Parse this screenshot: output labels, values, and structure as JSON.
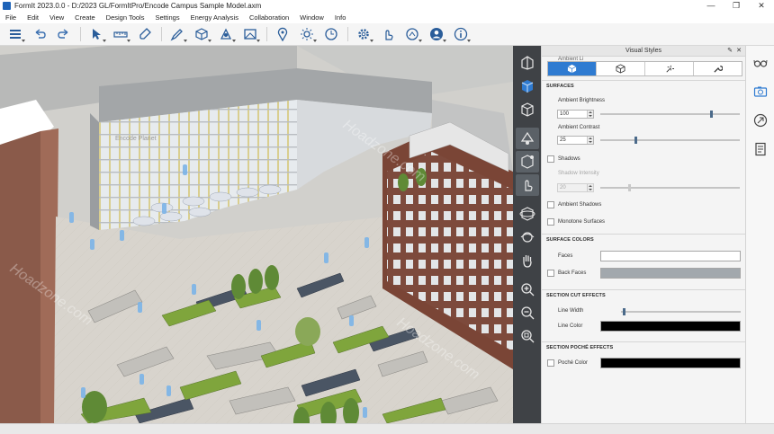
{
  "window": {
    "title": "FormIt 2023.0.0 - D:/2023 GL/FormItPro/Encode Campus Sample Model.axm",
    "controls": [
      "—",
      "❐",
      "✕"
    ]
  },
  "menu": [
    "File",
    "Edit",
    "View",
    "Create",
    "Design Tools",
    "Settings",
    "Energy Analysis",
    "Collaboration",
    "Window",
    "Info"
  ],
  "toolbar": {
    "icons": [
      "layers-icon",
      "undo-icon",
      "redo-icon",
      "select-icon",
      "measure-icon",
      "eyedropper-icon",
      "sketch-icon",
      "solid-icon",
      "edit-geometry-icon",
      "frame-icon",
      "location-icon",
      "sun-icon",
      "time-icon",
      "settings-icon",
      "gestures-icon",
      "share-icon",
      "account-icon",
      "help-icon"
    ]
  },
  "viewport": {
    "watermark": "Hoadzone.com",
    "sign_text": "Encode Planet"
  },
  "vertical_tools": [
    "perspective-icon",
    "solid-view-icon",
    "wireframe-icon",
    "paint-icon",
    "rotate-icon",
    "pan-icon",
    "orbit-icon",
    "orbit-alt-icon",
    "hand-icon",
    "zoom-icon",
    "zoom-out-icon",
    "zoom-extents-icon"
  ],
  "panel": {
    "title": "Visual Styles",
    "pin": "✎",
    "close": "✕",
    "ghost_label": "Ambient Li",
    "sections": {
      "surfaces": "SURFACES",
      "surface_colors": "SURFACE COLORS",
      "section_cut": "SECTION CUT EFFECTS",
      "section_poche": "SECTION POCHÉ EFFECTS"
    },
    "ambient_brightness": {
      "label": "Ambient Brightness",
      "value": "100",
      "slider": 0.8
    },
    "ambient_contrast": {
      "label": "Ambient Contrast",
      "value": "25",
      "slider": 0.25
    },
    "shadows": {
      "label": "Shadows"
    },
    "shadow_intensity": {
      "label": "Shadow Intensity",
      "value": "20",
      "slider": 0.2
    },
    "ambient_shadows": {
      "label": "Ambient Shadows"
    },
    "monotone": {
      "label": "Monotone Surfaces"
    },
    "faces": {
      "label": "Faces",
      "color": "#ffffff"
    },
    "back_faces": {
      "label": "Back Faces",
      "color": "#a2a8ad"
    },
    "line_width": {
      "label": "Line Width",
      "slider": 0.1
    },
    "line_color": {
      "label": "Line Color",
      "color": "#000000"
    },
    "poche_color": {
      "label": "Poché Color",
      "color": "#000000"
    }
  },
  "right_dock": [
    "glasses-icon",
    "camera-icon",
    "compass-icon",
    "properties-icon"
  ],
  "colors": {
    "accent": "#2f7bd1",
    "strip": "#3f4246"
  }
}
